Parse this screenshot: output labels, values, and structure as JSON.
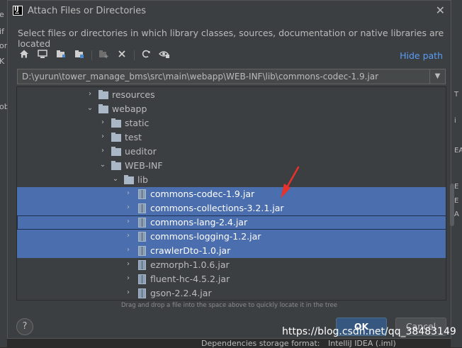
{
  "background": {
    "left_letters": [
      "e",
      "if",
      "or",
      "K",
      "ob"
    ],
    "right_letters": [
      "T",
      "i",
      "EA",
      "E",
      "E",
      "A"
    ],
    "status_text": "Dependencies storage format:",
    "status_value": "IntelliJ IDEA (.iml)"
  },
  "dialog": {
    "app_icon_letter": "IJ",
    "title": "Attach Files or Directories",
    "close_symbol": "✕",
    "subtitle": "Select files or directories in which library classes, sources, documentation or native libraries are located",
    "toolbar": {
      "hide_path_label": "Hide path",
      "icons": [
        "home-icon",
        "desktop-icon",
        "project-icon",
        "module-icon",
        "new-folder-icon",
        "delete-icon",
        "refresh-icon",
        "show-hidden-icon"
      ]
    },
    "path": "D:\\yurun\\tower_manage_bms\\src\\main\\webapp\\WEB-INF\\lib\\commons-codec-1.9.jar",
    "tree": [
      {
        "label": "resources",
        "type": "folder",
        "depth": 0,
        "arrow": "›",
        "selected": false
      },
      {
        "label": "webapp",
        "type": "folder",
        "depth": 0,
        "arrow": "⌄",
        "selected": false
      },
      {
        "label": "static",
        "type": "folder",
        "depth": 1,
        "arrow": "›",
        "selected": false
      },
      {
        "label": "test",
        "type": "folder",
        "depth": 1,
        "arrow": "›",
        "selected": false
      },
      {
        "label": "ueditor",
        "type": "folder",
        "depth": 1,
        "arrow": "›",
        "selected": false
      },
      {
        "label": "WEB-INF",
        "type": "folder",
        "depth": 1,
        "arrow": "⌄",
        "selected": false
      },
      {
        "label": "lib",
        "type": "folder",
        "depth": 2,
        "arrow": "⌄",
        "selected": false
      },
      {
        "label": "commons-codec-1.9.jar",
        "type": "jar",
        "depth": 3,
        "arrow": "›",
        "selected": true
      },
      {
        "label": "commons-collections-3.2.1.jar",
        "type": "jar",
        "depth": 3,
        "arrow": "›",
        "selected": true
      },
      {
        "label": "commons-lang-2.4.jar",
        "type": "jar",
        "depth": 3,
        "arrow": "›",
        "selected": true,
        "focused": true
      },
      {
        "label": "commons-logging-1.2.jar",
        "type": "jar",
        "depth": 3,
        "arrow": "›",
        "selected": true
      },
      {
        "label": "crawlerDto-1.0.jar",
        "type": "jar",
        "depth": 3,
        "arrow": "›",
        "selected": true
      },
      {
        "label": "ezmorph-1.0.6.jar",
        "type": "jar",
        "depth": 3,
        "arrow": "›",
        "selected": false
      },
      {
        "label": "fluent-hc-4.5.2.jar",
        "type": "jar",
        "depth": 3,
        "arrow": "›",
        "selected": false
      },
      {
        "label": "gson-2.2.4.jar",
        "type": "jar",
        "depth": 3,
        "arrow": "›",
        "selected": false
      }
    ],
    "hint": "Drag and drop a file into the space above to quickly locate it in the tree",
    "help_label": "?",
    "ok_label": "OK",
    "cancel_label": "Cancel"
  },
  "watermark": "https://blog.csdn.net/qq_38483149",
  "colors": {
    "selection": "#4b6eaf",
    "link": "#589df6",
    "annotation_arrow": "#e8312a"
  }
}
